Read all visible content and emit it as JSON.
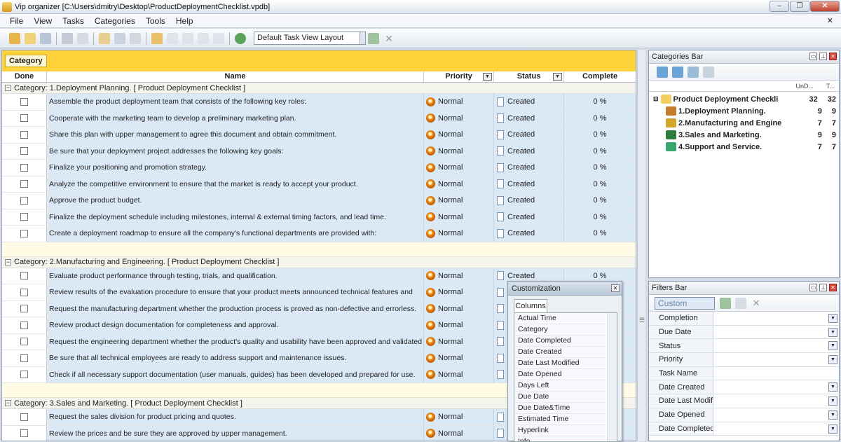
{
  "window": {
    "title": "Vip organizer [C:\\Users\\dmitry\\Desktop\\ProductDeploymentChecklist.vpdb]"
  },
  "menu": [
    "File",
    "View",
    "Tasks",
    "Categories",
    "Tools",
    "Help"
  ],
  "toolbar": {
    "layout_value": "Default Task View Layout"
  },
  "grid": {
    "group_chip": "Category",
    "columns": {
      "done": "Done",
      "name": "Name",
      "priority": "Priority",
      "status": "Status",
      "complete": "Complete"
    },
    "groups": [
      {
        "header": "Category: 1.Deployment Planning.    [ Product Deployment Checklist ]",
        "tasks": [
          {
            "name": "Assemble the product deployment team that consists of the following key roles:",
            "priority": "Normal",
            "status": "Created",
            "complete": "0 %"
          },
          {
            "name": "Cooperate with the marketing team to develop a preliminary marketing plan.",
            "priority": "Normal",
            "status": "Created",
            "complete": "0 %"
          },
          {
            "name": "Share this plan with upper management to agree this document and obtain commitment.",
            "priority": "Normal",
            "status": "Created",
            "complete": "0 %"
          },
          {
            "name": "Be sure that your deployment project addresses the following key goals:",
            "priority": "Normal",
            "status": "Created",
            "complete": "0 %"
          },
          {
            "name": "Finalize your positioning and promotion strategy.",
            "priority": "Normal",
            "status": "Created",
            "complete": "0 %"
          },
          {
            "name": "Analyze the competitive environment to ensure that the market is ready to accept your product.",
            "priority": "Normal",
            "status": "Created",
            "complete": "0 %"
          },
          {
            "name": "Approve the product budget.",
            "priority": "Normal",
            "status": "Created",
            "complete": "0 %"
          },
          {
            "name": "Finalize the deployment schedule including milestones, internal & external timing factors, and lead time.",
            "priority": "Normal",
            "status": "Created",
            "complete": "0 %"
          },
          {
            "name": "Create a deployment roadmap to ensure all the company's functional departments are provided with:",
            "priority": "Normal",
            "status": "Created",
            "complete": "0 %"
          }
        ]
      },
      {
        "header": "Category: 2.Manufacturing and Engineering.    [ Product Deployment Checklist ]",
        "tasks": [
          {
            "name": "Evaluate product performance through testing, trials, and qualification.",
            "priority": "Normal",
            "status": "Created",
            "complete": "0 %"
          },
          {
            "name": "Review results of the evaluation procedure to ensure that your product meets announced technical features and",
            "priority": "Normal",
            "status": "",
            "complete": ""
          },
          {
            "name": "Request the manufacturing department whether the production process is proved as non-defective and errorless.",
            "priority": "Normal",
            "status": "",
            "complete": ""
          },
          {
            "name": "Review product design documentation for completeness and approval.",
            "priority": "Normal",
            "status": "",
            "complete": ""
          },
          {
            "name": "Request the engineering department whether the product's quality and usability have been approved and validated by",
            "priority": "Normal",
            "status": "",
            "complete": ""
          },
          {
            "name": "Be sure that all technical employees are ready to address support and maintenance issues.",
            "priority": "Normal",
            "status": "",
            "complete": ""
          },
          {
            "name": "Check if all necessary support documentation (user manuals, guides) has been developed and prepared for use.",
            "priority": "Normal",
            "status": "",
            "complete": ""
          }
        ]
      },
      {
        "header": "Category: 3.Sales and Marketing.    [ Product Deployment Checklist ]",
        "tasks": [
          {
            "name": "Request the sales division for product pricing and quotes.",
            "priority": "Normal",
            "status": "",
            "complete": ""
          },
          {
            "name": "Review the prices and be sure they are approved by upper management.",
            "priority": "Normal",
            "status": "",
            "complete": ""
          }
        ]
      }
    ]
  },
  "categories_bar": {
    "title": "Categories Bar",
    "col_undone": "UnD...",
    "col_total": "T...",
    "root": {
      "label": "Product Deployment Checklis",
      "undone": "32",
      "total": "32"
    },
    "items": [
      {
        "label": "1.Deployment Planning.",
        "undone": "9",
        "total": "9",
        "color": "#c77b2c"
      },
      {
        "label": "2.Manufacturing and Engine",
        "undone": "7",
        "total": "7",
        "color": "#d3a62b"
      },
      {
        "label": "3.Sales and Marketing.",
        "undone": "9",
        "total": "9",
        "color": "#2e7d3e"
      },
      {
        "label": "4.Support and Service.",
        "undone": "7",
        "total": "7",
        "color": "#3aa56d"
      }
    ]
  },
  "filters_bar": {
    "title": "Filters Bar",
    "preset": "Custom",
    "fields": [
      "Completion",
      "Due Date",
      "Status",
      "Priority",
      "Task Name",
      "Date Created",
      "Date Last Modifie",
      "Date Opened",
      "Date Completed"
    ]
  },
  "customization": {
    "title": "Customization",
    "tab": "Columns",
    "items": [
      "Actual Time",
      "Category",
      "Date Completed",
      "Date Created",
      "Date Last Modified",
      "Date Opened",
      "Days Left",
      "Due Date",
      "Due Date&Time",
      "Estimated Time",
      "Hyperlink",
      "Info"
    ]
  }
}
